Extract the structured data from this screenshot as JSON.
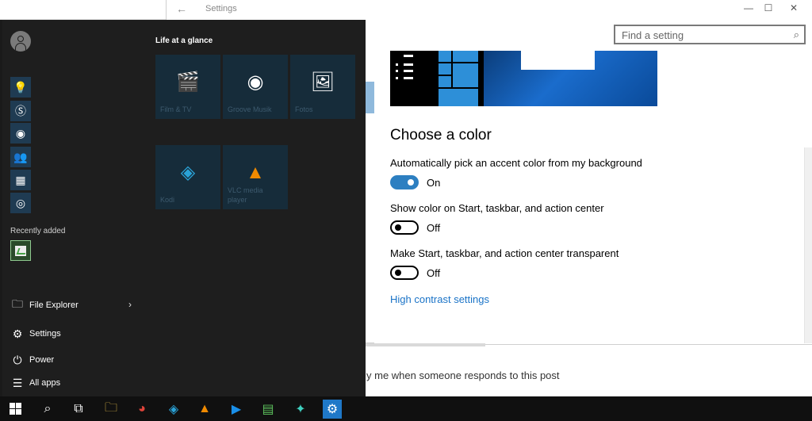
{
  "settings_window": {
    "title": "Settings",
    "search_placeholder": "Find a setting",
    "section_title": "Choose a color",
    "options": [
      {
        "label": "Automatically pick an accent color from my background",
        "state": "On"
      },
      {
        "label": "Show color on Start, taskbar, and action center",
        "state": "Off"
      },
      {
        "label": "Make Start, taskbar, and action center transparent",
        "state": "Off"
      }
    ],
    "link": "High contrast settings"
  },
  "background_page": {
    "notify_text": "y me when someone responds to this post"
  },
  "start_menu": {
    "tiles_header": "Life at a glance",
    "tiles": [
      {
        "label": "Film & TV",
        "icon": "clapperboard-icon"
      },
      {
        "label": "Groove Musik",
        "icon": "groove-disc-icon"
      },
      {
        "label": "Fotos",
        "icon": "photo-icon"
      },
      {
        "label": "Kodi",
        "icon": "kodi-icon"
      },
      {
        "label": "VLC media player",
        "icon": "vlc-cone-icon"
      }
    ],
    "recently_added": "Recently added",
    "nav": {
      "file_explorer": "File Explorer",
      "settings": "Settings",
      "power": "Power",
      "all_apps": "All apps"
    }
  },
  "colors": {
    "accent": "#2d7fc1",
    "link": "#1a73c7",
    "start_bg": "#1e1e1e",
    "tile_bg": "#162c3a",
    "taskbar_bg": "#101010"
  }
}
